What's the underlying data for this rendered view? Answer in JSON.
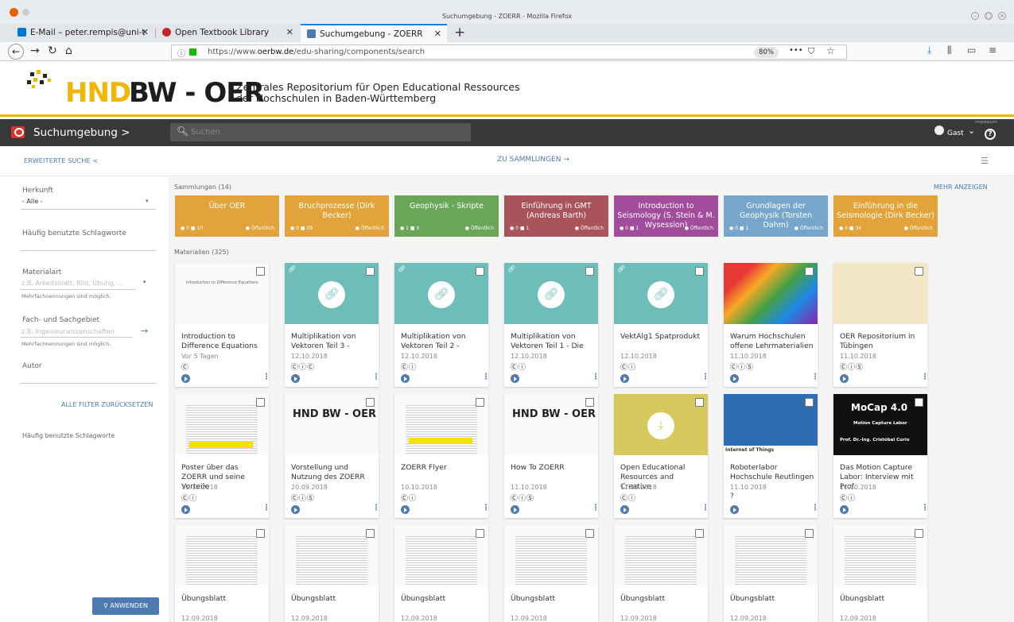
{
  "window": {
    "title": "Suchumgebung - ZOERR - Mozilla Firefox"
  },
  "tabs": [
    {
      "label": "E-Mail – peter.rempis@uni-t"
    },
    {
      "label": "Open Textbook Library"
    },
    {
      "label": "Suchumgebung - ZOERR"
    }
  ],
  "nav": {
    "url_prefix": "https://www.",
    "url_domain": "oerbw.de",
    "url_rest": "/edu-sharing/components/search",
    "zoom": "80%"
  },
  "header": {
    "logo_hnd": "HND",
    "logo_bwoer": "BW - OER",
    "tagline_line1": "Zentrales Repositorium für Open Educational Ressources",
    "tagline_line2": "der Hochschulen in Baden-Württemberg"
  },
  "toolbar": {
    "crumb": "Suchumgebung >",
    "search_placeholder": "Suchen",
    "impressum": "Impressum",
    "user": "Gast"
  },
  "subbar": {
    "advanced": "ERWEITERTE SUCHE <",
    "collections": "ZU SAMMLUNGEN →"
  },
  "sidebar": {
    "herkunft_label": "Herkunft",
    "herkunft_value": "- Alle -",
    "keywords_label": "Häufig benutzte Schlagworte",
    "materialart_label": "Materialart",
    "materialart_placeholder": "z.B. Arbeitsblatt, Bild, Übung, ...",
    "multi1": "Mehrfachnennungen sind möglich.",
    "fach_label": "Fach- und Sachgebiet",
    "fach_placeholder": "z.B. Ingenieurwissenschaften",
    "multi2": "Mehrfachnennungen sind möglich.",
    "autor_label": "Autor",
    "reset": "ALLE FILTER ZURÜCKSETZEN",
    "keywords_label2": "Häufig benutzte Schlagworte",
    "apply": "ANWENDEN"
  },
  "collections_title": "Sammlungen (14)",
  "more": "MEHR ANZEIGEN",
  "collections": [
    {
      "title": "Über OER",
      "stat": "● 0  ■ 10",
      "pub": "● Öffentlich",
      "color": "#e2a43a"
    },
    {
      "title": "Bruchprozesse (Dirk Becker)",
      "stat": "● 0  ■ 29",
      "pub": "● Öffentlich",
      "color": "#e2a43a"
    },
    {
      "title": "Geophysik - Skripte",
      "stat": "● 1  ■ 0",
      "pub": "● Öffentlich",
      "color": "#6aa657"
    },
    {
      "title": "Einführung in GMT (Andreas Barth)",
      "stat": "● 0  ■ 1",
      "pub": "● Öffentlich",
      "color": "#a9535a"
    },
    {
      "title": "Introduction to Seismology (S. Stein & M. Wysession)",
      "stat": "● 0  ■ 1",
      "pub": "● Öffentlich",
      "color": "#a24d9c"
    },
    {
      "title": "Grundlagen der Geophysik (Torsten Dahm)",
      "stat": "● 0  ■ 1",
      "pub": "● Öffentlich",
      "color": "#76a6cc"
    },
    {
      "title": "Einführung in die Seismologie (Dirk Becker)",
      "stat": "● 0  ■ 34",
      "pub": "● Öffentlich",
      "color": "#e2a43a"
    }
  ],
  "materials_title": "Materialien (325)",
  "materials": [
    {
      "title": "Introduction to Difference Equations",
      "date": "Vor 5 Tagen",
      "license": "Ⓒ"
    },
    {
      "title": "Multiplikation von Vektoren Teil 3 -",
      "date": "12.10.2018",
      "license": "ⒸⓘⒸ"
    },
    {
      "title": "Multiplikation von Vektoren Teil 2 -",
      "date": "12.10.2018",
      "license": "Ⓒⓘ"
    },
    {
      "title": "Multiplikation von Vektoren Teil 1 - Die",
      "date": "12.10.2018",
      "license": "Ⓒⓘ"
    },
    {
      "title": "VektAlg1 Spatprodukt",
      "date": "12.10.2018",
      "license": "Ⓒⓘ"
    },
    {
      "title": "Warum Hochschulen offene Lehrmaterialien",
      "date": "11.10.2018",
      "license": "ⒸⓘⓈ"
    },
    {
      "title": "OER Repositorium in Tübingen",
      "date": "11.10.2018",
      "license": "ⒸⓘⓈ"
    },
    {
      "title": "Poster über das ZOERR und seine Vorteile",
      "date": "11.10.2018",
      "license": "Ⓒⓘ"
    },
    {
      "title": "Vorstellung und Nutzung des ZOERR",
      "date": "20.09.2018",
      "license": "ⒸⓘⓈ"
    },
    {
      "title": "ZOERR Flyer",
      "date": "10.10.2018",
      "license": "Ⓒⓘ"
    },
    {
      "title": "How To ZOERR",
      "date": "11.10.2018",
      "license": "ⒸⓘⓈ"
    },
    {
      "title": "Open Educational Resources and Creative",
      "date": "11.10.2018",
      "license": "Ⓒⓘ"
    },
    {
      "title": "Roboterlabor Hochschule Reutlingen",
      "date": "11.10.2018",
      "license": "?"
    },
    {
      "title": "Das Motion Capture Labor: Interview mit Prof.",
      "date": "11.10.2018",
      "license": "Ⓒⓘ"
    },
    {
      "title": "Übungsblatt",
      "date": "12.09.2018"
    },
    {
      "title": "Übungsblatt",
      "date": "12.09.2018"
    },
    {
      "title": "Übungsblatt",
      "date": "12.09.2018"
    },
    {
      "title": "Übungsblatt",
      "date": "12.09.2018"
    },
    {
      "title": "Übungsblatt",
      "date": "12.09.2018"
    },
    {
      "title": "Übungsblatt",
      "date": "12.09.2018"
    },
    {
      "title": "Übungsblatt",
      "date": "12.09.2018"
    }
  ],
  "thumb_text": {
    "m0": "Introduction to Difference Equations",
    "m13a": "MoCap 4.0",
    "m13b": "Motion Capture Labor",
    "m13c": "Prof. Dr.-Ing. Cristóbal Curio",
    "m12": "Internet of Things",
    "oer_logo": "HND BW - OER"
  }
}
